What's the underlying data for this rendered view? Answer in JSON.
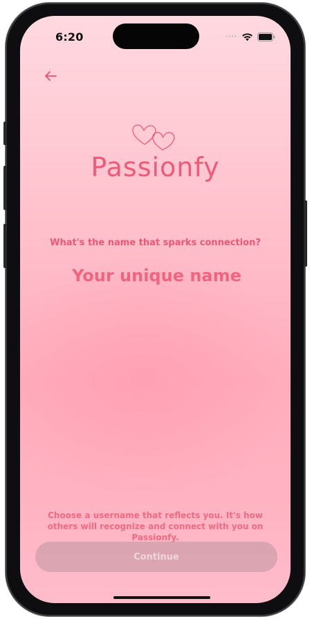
{
  "status_bar": {
    "time": "6:20",
    "signal_icon": "signal-dots-icon",
    "wifi_icon": "wifi-icon",
    "battery_icon": "battery-icon"
  },
  "header": {
    "back_icon": "arrow-left-icon"
  },
  "logo": {
    "icon": "two-hearts-icon",
    "brand_name": "Passionfy"
  },
  "form": {
    "question": "What's the name that sparks connection?",
    "name_input": {
      "value": "",
      "placeholder": "Your unique name"
    }
  },
  "footer": {
    "helper_text": "Choose a username that reflects you. It's how others will recognize and connect with you on Passionfy.",
    "continue_label": "Continue"
  },
  "colors": {
    "accent": "#ee5a77",
    "background_top": "#ffd9e0",
    "background_bottom": "#ffb4c3"
  }
}
